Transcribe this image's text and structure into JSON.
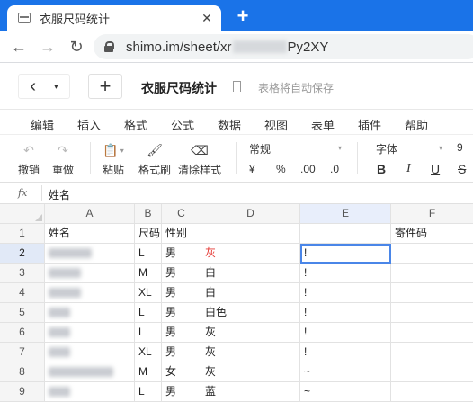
{
  "browser": {
    "tab_title": "衣服尺码统计",
    "tab_close": "✕",
    "new_tab": "+",
    "url_prefix": "shimo.im/sheet/xr",
    "url_suffix": "Py2XY"
  },
  "header": {
    "back_icon": "‹",
    "dropdown_icon": "▾",
    "add_icon": "+",
    "title": "衣服尺码统计",
    "autosave": "表格将自动保存"
  },
  "menu": [
    "编辑",
    "插入",
    "格式",
    "公式",
    "数据",
    "视图",
    "表单",
    "插件",
    "帮助"
  ],
  "toolbar": {
    "undo": "撤销",
    "redo": "重做",
    "paste": "粘贴",
    "format_painter": "格式刷",
    "clear_format": "清除样式",
    "number_format": "常规",
    "currency": "¥",
    "percent": "%",
    "decimal_add": ".00",
    "decimal_remove": ".0",
    "font": "字体",
    "font_size": "9",
    "bold": "B",
    "italic": "I",
    "underline": "U",
    "strike": "S"
  },
  "formula_bar": {
    "fx": "fx",
    "value": "姓名"
  },
  "sheet": {
    "columns": [
      "A",
      "B",
      "C",
      "D",
      "E",
      "F"
    ],
    "rows": [
      {
        "n": "1",
        "a": "姓名",
        "b": "尺码",
        "c": "性别",
        "d": "",
        "e": "",
        "f": "寄件码"
      },
      {
        "n": "2",
        "a": "",
        "b": "L",
        "c": "男",
        "d": "灰",
        "e": "!",
        "f": ""
      },
      {
        "n": "3",
        "a": "",
        "b": "M",
        "c": "男",
        "d": "白",
        "e": "!",
        "f": ""
      },
      {
        "n": "4",
        "a": "",
        "b": "XL",
        "c": "男",
        "d": "白",
        "e": "!",
        "f": ""
      },
      {
        "n": "5",
        "a": "",
        "b": "L",
        "c": "男",
        "d": "白色",
        "e": "!",
        "f": ""
      },
      {
        "n": "6",
        "a": "",
        "b": "L",
        "c": "男",
        "d": "灰",
        "e": "!",
        "f": ""
      },
      {
        "n": "7",
        "a": "",
        "b": "XL",
        "c": "男",
        "d": "灰",
        "e": "!",
        "f": ""
      },
      {
        "n": "8",
        "a": "",
        "b": "M",
        "c": "女",
        "d": "灰",
        "e": "~",
        "f": ""
      },
      {
        "n": "9",
        "a": "",
        "b": "L",
        "c": "男",
        "d": "蓝",
        "e": "~",
        "f": ""
      }
    ]
  },
  "colors": {
    "chrome_blue": "#1a73e8",
    "selection_blue": "#4a86e8",
    "red_text": "#e53935"
  }
}
